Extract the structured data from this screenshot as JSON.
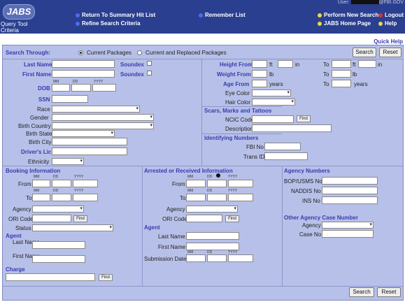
{
  "header": {
    "logo": "JABS",
    "app_title": "Query Tool Criteria",
    "user_label": "User:",
    "user_suffix": "@FBI.GOV",
    "links": {
      "return_summary": "Return To Summary Hit List",
      "refine": "Refine Search Criteria",
      "remember": "Remember List",
      "new_search": "Perform New Search",
      "logout": "Logout",
      "home": "JABS Home Page",
      "help": "Help"
    }
  },
  "quick_help": "Quick Help",
  "search_through": {
    "label": "Search Through:",
    "opt1": "Current Packages",
    "opt2": "Current and Replaced Packages"
  },
  "buttons": {
    "search": "Search",
    "reset": "Reset",
    "find": "Find"
  },
  "person": {
    "last_name": "Last Name",
    "first_name": "First Name",
    "soundex": "Soundex",
    "dob": "DOB",
    "mm": "MM",
    "dd": "DD",
    "yyyy": "YYYY",
    "ssn": "SSN",
    "race": "Race",
    "gender": "Gender",
    "birth_country": "Birth Country",
    "birth_state": "Birth State",
    "birth_city": "Birth City",
    "drivers_lic": "Driver's Lic",
    "ethnicity": "Ethnicity"
  },
  "physical": {
    "height_from": "Height From",
    "ft": "ft",
    "in": "in",
    "to": "To",
    "weight_from": "Weight From",
    "lb": "lb",
    "age_from": "Age From",
    "years": "years",
    "eye_color": "Eye Color",
    "hair_color": "Hair Color"
  },
  "smt": {
    "title": "Scars, Marks and Tattoos",
    "ncic_code": "NCIC Code",
    "description": "Description"
  },
  "ids": {
    "title": "Identifying Numbers",
    "fbi_no": "FBI No",
    "trans_id": "Trans ID"
  },
  "booking": {
    "title": "Booking Information",
    "from": "From",
    "to": "To",
    "agency": "Agency",
    "ori_code": "ORI Code",
    "status": "Status",
    "agent": "Agent",
    "last_name": "Last Name",
    "first_name": "First Name",
    "charge": "Charge"
  },
  "arrest": {
    "title": "Arrested or Received Information",
    "from": "From",
    "to": "To",
    "agency": "Agency",
    "ori_code": "ORI Code",
    "agent": "Agent",
    "last_name": "Last Name",
    "first_name": "First Name",
    "submission_date": "Submission Date"
  },
  "agency_numbers": {
    "title": "Agency Numbers",
    "bop": "BOP/USMS No",
    "naddis": "NADDIS No",
    "ins": "INS No"
  },
  "other_case": {
    "title": "Other Agency Case Number",
    "agency": "Agency",
    "case_no": "Case No"
  },
  "colors": {
    "header": "#2a3f8f",
    "panel": "#b7c0e8",
    "label_blue": "#3a3ab0"
  }
}
